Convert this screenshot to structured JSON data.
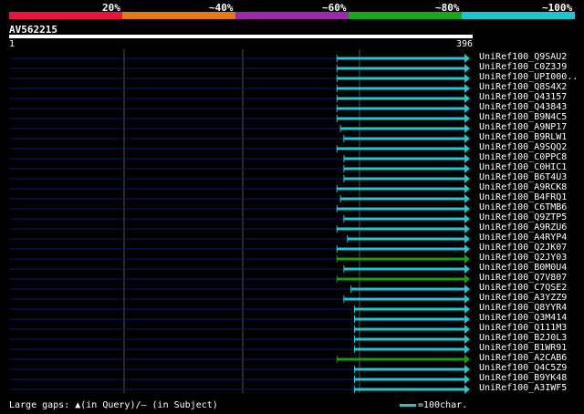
{
  "scale": {
    "labels": [
      "20%",
      "~40%",
      "~60%",
      "~80%",
      "~100%"
    ],
    "colors": [
      "#e8143c",
      "#e87a14",
      "#9b2aa8",
      "#1aa51a",
      "#1ec4d0"
    ]
  },
  "query": {
    "name": "AV562215",
    "start": "1",
    "end": "396"
  },
  "colors": {
    "hit": "#22c5d2",
    "hit_alt": "#14a014",
    "track": "#0a1a6e",
    "grid": "#555555"
  },
  "chart_data": {
    "type": "alignment",
    "query_length": 396,
    "hits": [
      {
        "name": "UniRef100_Q9SAU2",
        "start": 282,
        "end": 396,
        "color": "cyan"
      },
      {
        "name": "UniRef100_C0Z3J9",
        "start": 282,
        "end": 396,
        "color": "cyan"
      },
      {
        "name": "UniRef100_UPI000..",
        "start": 282,
        "end": 396,
        "color": "cyan"
      },
      {
        "name": "UniRef100_Q8S4X2",
        "start": 282,
        "end": 396,
        "color": "cyan"
      },
      {
        "name": "UniRef100_Q43157",
        "start": 282,
        "end": 396,
        "color": "cyan"
      },
      {
        "name": "UniRef100_Q43843",
        "start": 282,
        "end": 396,
        "color": "cyan"
      },
      {
        "name": "UniRef100_B9N4C5",
        "start": 282,
        "end": 396,
        "color": "cyan"
      },
      {
        "name": "UniRef100_A9NP17",
        "start": 285,
        "end": 396,
        "color": "cyan"
      },
      {
        "name": "UniRef100_B9RLW1",
        "start": 288,
        "end": 396,
        "color": "cyan"
      },
      {
        "name": "UniRef100_A9SQQ2",
        "start": 282,
        "end": 396,
        "color": "cyan"
      },
      {
        "name": "UniRef100_C0PPC8",
        "start": 288,
        "end": 396,
        "color": "cyan"
      },
      {
        "name": "UniRef100_C0HIC1",
        "start": 288,
        "end": 396,
        "color": "cyan"
      },
      {
        "name": "UniRef100_B6T4U3",
        "start": 288,
        "end": 396,
        "color": "cyan"
      },
      {
        "name": "UniRef100_A9RCK8",
        "start": 282,
        "end": 396,
        "color": "cyan"
      },
      {
        "name": "UniRef100_B4FRQ1",
        "start": 285,
        "end": 396,
        "color": "cyan"
      },
      {
        "name": "UniRef100_C6TMB6",
        "start": 282,
        "end": 396,
        "color": "cyan"
      },
      {
        "name": "UniRef100_Q9ZTP5",
        "start": 288,
        "end": 396,
        "color": "cyan"
      },
      {
        "name": "UniRef100_A9RZU6",
        "start": 282,
        "end": 396,
        "color": "cyan"
      },
      {
        "name": "UniRef100_A4RYP4",
        "start": 291,
        "end": 396,
        "color": "cyan"
      },
      {
        "name": "UniRef100_Q2JK07",
        "start": 282,
        "end": 396,
        "color": "cyan"
      },
      {
        "name": "UniRef100_Q2JY03",
        "start": 282,
        "end": 396,
        "color": "green"
      },
      {
        "name": "UniRef100_B0M0U4",
        "start": 288,
        "end": 396,
        "color": "cyan"
      },
      {
        "name": "UniRef100_Q7V807",
        "start": 282,
        "end": 396,
        "color": "green"
      },
      {
        "name": "UniRef100_C7QSE2",
        "start": 294,
        "end": 396,
        "color": "cyan"
      },
      {
        "name": "UniRef100_A3YZZ9",
        "start": 288,
        "end": 396,
        "color": "cyan"
      },
      {
        "name": "UniRef100_Q8YYR4",
        "start": 297,
        "end": 396,
        "color": "cyan"
      },
      {
        "name": "UniRef100_Q3M414",
        "start": 297,
        "end": 396,
        "color": "cyan"
      },
      {
        "name": "UniRef100_Q111M3",
        "start": 297,
        "end": 396,
        "color": "cyan"
      },
      {
        "name": "UniRef100_B2J0L3",
        "start": 297,
        "end": 396,
        "color": "cyan"
      },
      {
        "name": "UniRef100_B1WR91",
        "start": 297,
        "end": 396,
        "color": "cyan"
      },
      {
        "name": "UniRef100_A2CAB6",
        "start": 282,
        "end": 396,
        "color": "green"
      },
      {
        "name": "UniRef100_Q4C5Z9",
        "start": 297,
        "end": 396,
        "color": "cyan"
      },
      {
        "name": "UniRef100_B9YK48",
        "start": 297,
        "end": 396,
        "color": "cyan"
      },
      {
        "name": "UniRef100_A3IWF5",
        "start": 297,
        "end": 396,
        "color": "cyan"
      }
    ]
  },
  "footer": {
    "text": "Large gaps: ▲(in Query)/— (in Subject)"
  },
  "legend": {
    "text": "=100char."
  }
}
